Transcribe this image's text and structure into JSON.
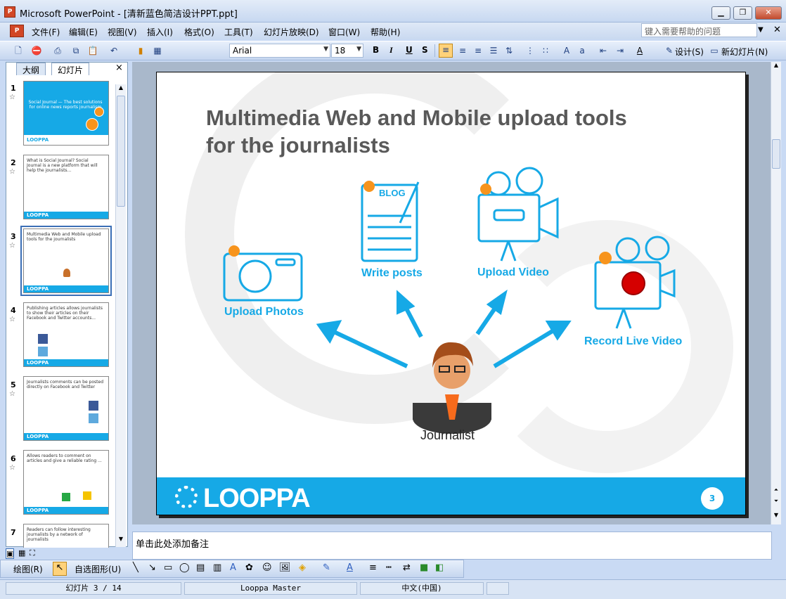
{
  "window": {
    "app_icon": "P",
    "title": "Microsoft PowerPoint - [清新蓝色简洁设计PPT.ppt]",
    "minimize": "▁",
    "restore": "❐",
    "close": "✕"
  },
  "menu": {
    "items": [
      "文件(F)",
      "编辑(E)",
      "视图(V)",
      "插入(I)",
      "格式(O)",
      "工具(T)",
      "幻灯片放映(D)",
      "窗口(W)",
      "帮助(H)"
    ],
    "help_placeholder": "键入需要帮助的问题"
  },
  "toolbar": {
    "font": "Arial",
    "size": "18",
    "bold": "B",
    "italic": "I",
    "underline": "U",
    "shadow": "S",
    "design_label": "设计(S)",
    "new_slide_label": "新幻灯片(N)"
  },
  "left_panel": {
    "tabs": [
      "大纲",
      "幻灯片"
    ],
    "close": "×",
    "slides": [
      {
        "num": "1",
        "text": "Social Journal — The best solutions for online news reports journalism",
        "footer": "LOOPPA"
      },
      {
        "num": "2",
        "text": "What is Social Journal? Social Journal is a new platform that will help the journalists...",
        "footer": "LOOPPA"
      },
      {
        "num": "3",
        "text": "Multimedia Web and Mobile upload tools for the journalists",
        "footer": "LOOPPA"
      },
      {
        "num": "4",
        "text": "Publishing articles allows journalists to show their articles on their Facebook and Twitter accounts...",
        "footer": "LOOPPA"
      },
      {
        "num": "5",
        "text": "Journalists comments can be posted directly on Facebook and Twitter",
        "footer": "LOOPPA"
      },
      {
        "num": "6",
        "text": "Allows readers to comment on articles and give a reliable rating ...",
        "footer": "LOOPPA"
      },
      {
        "num": "7",
        "text": "Readers can follow interesting journalists by a network of journalists",
        "footer": ""
      }
    ]
  },
  "slide": {
    "title": "Multimedia Web and Mobile upload tools for the journalists",
    "upload_photos": "Upload Photos",
    "write_posts": "Write posts",
    "upload_video": "Upload Video",
    "record_live_video": "Record Live Video",
    "blog_label": "BLOG",
    "journalist": "Journalist",
    "footer_logo": "LOOPPA",
    "page_number": "3",
    "accent_color": "#16a9e6",
    "dot_color": "#f7941d"
  },
  "notes": {
    "placeholder": "单击此处添加备注"
  },
  "drawbar": {
    "draw_label": "绘图(R)",
    "autoshapes_label": "自选图形(U)"
  },
  "status": {
    "slide_indicator": "幻灯片 3 / 14",
    "master": "Looppa Master",
    "language": "中文(中国)"
  }
}
